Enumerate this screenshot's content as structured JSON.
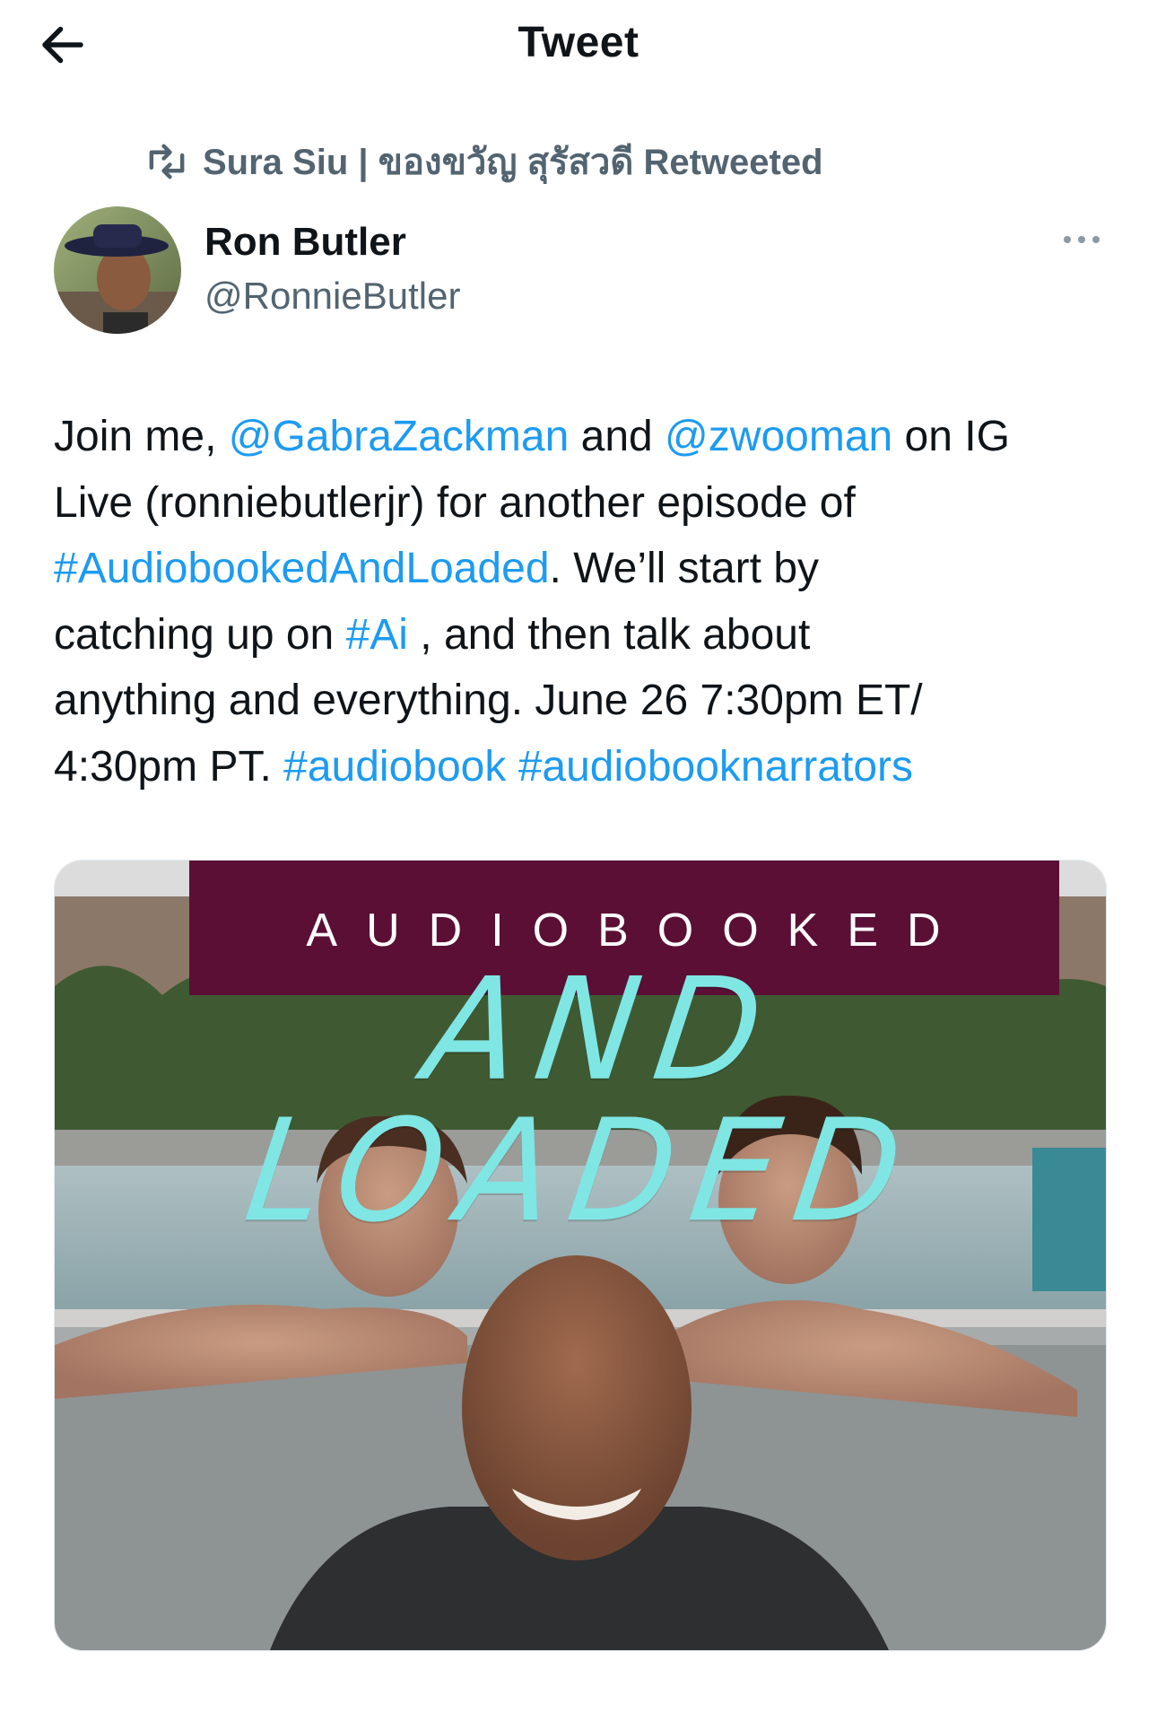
{
  "header": {
    "title": "Tweet",
    "back_icon": "arrow-left-icon"
  },
  "retweet": {
    "icon": "retweet-icon",
    "text": "Sura Siu | ของขวัญ สุรัสวดี Retweeted"
  },
  "author": {
    "display_name": "Ron Butler",
    "handle": "@RonnieButler",
    "more_icon": "more-dots-icon"
  },
  "tweet": {
    "line1": {
      "t1": "Join me, ",
      "m1": "@GabraZackman",
      "t2": " and ",
      "m2": "@zwooman",
      "t3": " on IG"
    },
    "line2": {
      "t1": "Live (ronniebutlerjr) for another episode of"
    },
    "line3": {
      "h1": "#AudiobookedAndLoaded",
      "t1": ". We’ll start by"
    },
    "line4": {
      "t1": "catching up on ",
      "h1": "#Ai",
      "t2": " , and then talk about"
    },
    "line5": {
      "t1": "anything and everything.  June 26 7:30pm ET/"
    },
    "line6": {
      "t1": "4:30pm PT.  ",
      "h1": "#audiobook",
      "t2": " ",
      "h2": "#audiobooknarrators"
    }
  },
  "media": {
    "banner_text": "AUDIOBOOKED",
    "script_text": "AND LOADED"
  },
  "colors": {
    "link": "#1d9bf0",
    "secondary_text": "#536471",
    "banner": "#5b0f35",
    "script_text": "#7fe6e4"
  }
}
